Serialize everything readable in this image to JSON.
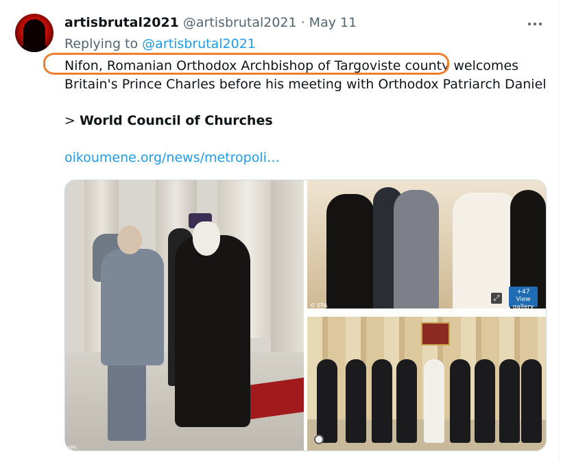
{
  "tweet": {
    "display_name": "artisbrutal2021",
    "handle": "@artisbrutal2021",
    "separator": "·",
    "date": "May 11",
    "more_icon": "more-horizontal-icon",
    "replying_prefix": "Replying to",
    "replying_handle": "@artisbrutal2021",
    "text_line1": "Nifon, Romanian Orthodox Archbishop of Targoviste county welcomes",
    "text_line2": "Britain's Prince Charles before his meeting with Orthodox Patriarch  Daniel",
    "heading_prefix": "> ",
    "heading_bold": "World Council of Churches",
    "link": "oikoumene.org/news/metropoli…"
  },
  "media": {
    "photo_left_tag": "EPA",
    "photo_tr_tag": "© EPA",
    "gallery_count": "+47",
    "gallery_label": "View gallery"
  },
  "colors": {
    "accent": "#1d9bf0",
    "muted": "#536471",
    "highlight": "#f07d2c"
  }
}
